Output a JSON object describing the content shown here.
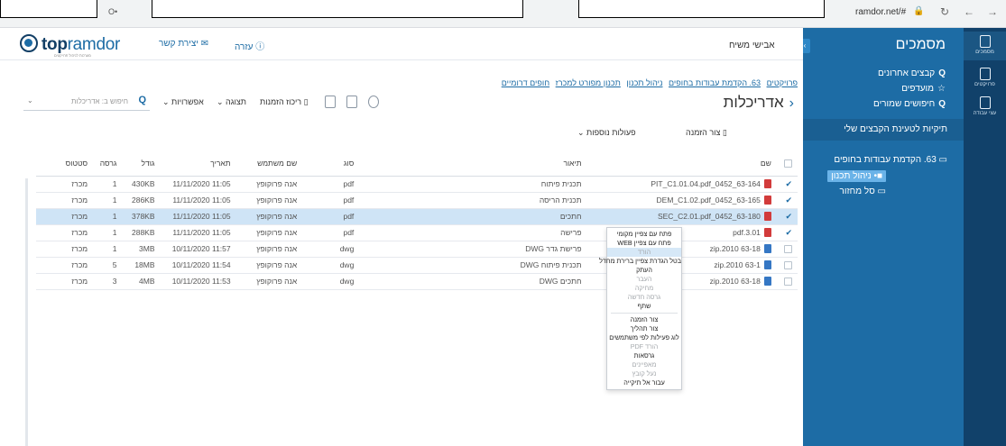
{
  "browser": {
    "url": "ramdor.net/#"
  },
  "app": {
    "logo_bold": "top",
    "logo_light": "ramdor",
    "logo_tagline": "מערכות לניהול פרויקטים",
    "help": "עזרה",
    "contact": "יצירת קשר",
    "user": "אבישי משיח"
  },
  "rail": [
    {
      "label": "מסמכים"
    },
    {
      "label": "פרויקטים"
    },
    {
      "label": "עצי עבודה"
    }
  ],
  "nav": {
    "title": "מסמכים",
    "links": [
      {
        "label": "קבצים אחרונים",
        "icon": "search-icon"
      },
      {
        "label": "מועדפים",
        "icon": "star-icon"
      },
      {
        "label": "חיפושים שמורים",
        "icon": "search-icon"
      }
    ],
    "upload_section": "תיקיות לטעינת הקבצים שלי",
    "tree": [
      {
        "label": "63. הקדמת עבודות בחופים"
      },
      {
        "label": "ניהול תכנון"
      },
      {
        "label": "סל מחזור"
      }
    ]
  },
  "breadcrumb": [
    "פרויקטים",
    "63. הקדמת עבודות בחופים",
    "ניהול תכנון",
    "תכנון מפורט למכרז",
    "חופים דרומיים"
  ],
  "heading": "אדריכלות",
  "toolbar": {
    "order_basket": "ריכוז הזמנות",
    "view": "תצוגה",
    "options": "אפשרויות",
    "search_placeholder": "חיפוש ב: אדריכלות",
    "create_order": "צור הזמנה",
    "more_actions": "פעולות נוספות"
  },
  "table": {
    "headers": [
      "שם",
      "תיאור",
      "סוג",
      "שם משתמש",
      "תאריך",
      "גודל",
      "גרסה",
      "סטטוס"
    ],
    "rows": [
      {
        "name": "63-164_0452_PIT_C1.01.04.pdf",
        "desc": "תכנית פיתוח",
        "type": "pdf",
        "user": "אנה פרוקופץ",
        "date": "11:05 11/11/2020",
        "size": "430KB",
        "ver": "1",
        "status": "מכרז",
        "checked": true,
        "ftype": "pdf"
      },
      {
        "name": "63-165_0452_DEM_C1.02.pdf",
        "desc": "תכנית הריסה",
        "type": "pdf",
        "user": "אנה פרוקופץ",
        "date": "11:05 11/11/2020",
        "size": "286KB",
        "ver": "1",
        "status": "מכרז",
        "checked": true,
        "ftype": "pdf"
      },
      {
        "name": "63-180_0452_SEC_C2.01.pdf",
        "desc": "חתכים",
        "type": "pdf",
        "user": "אנה פרוקופץ",
        "date": "11:05 11/11/2020",
        "size": "378KB",
        "ver": "1",
        "status": "מכרז",
        "checked": true,
        "ftype": "pdf"
      },
      {
        "name": "3.01.pdf",
        "desc": "פרישה",
        "type": "pdf",
        "user": "אנה פרוקופץ",
        "date": "11:05 11/11/2020",
        "size": "288KB",
        "ver": "1",
        "status": "מכרז",
        "checked": true,
        "ftype": "pdf"
      },
      {
        "name": "63-18 2010.zip",
        "desc": "פרישת גדר DWG",
        "type": "dwg",
        "user": "אנה פרוקופץ",
        "date": "11:57 10/11/2020",
        "size": "3MB",
        "ver": "1",
        "status": "מכרז",
        "checked": false,
        "ftype": "dwg"
      },
      {
        "name": "63-1 2010.zip",
        "desc": "תכנית פיתוח DWG",
        "type": "dwg",
        "user": "אנה פרוקופץ",
        "date": "11:54 10/11/2020",
        "size": "18MB",
        "ver": "5",
        "status": "מכרז",
        "checked": false,
        "ftype": "dwg"
      },
      {
        "name": "63-18 2010.zip",
        "desc": "חתכים DWG",
        "type": "dwg",
        "user": "אנה פרוקופץ",
        "date": "11:53 10/11/2020",
        "size": "4MB",
        "ver": "3",
        "status": "מכרז",
        "checked": false,
        "ftype": "dwg"
      }
    ]
  },
  "context_menu": {
    "items": [
      {
        "label": "פתח עם צפיין מקומי",
        "disabled": false
      },
      {
        "label": "פתח עם צפיין WEB",
        "disabled": false
      },
      {
        "label": "הורד",
        "disabled": true,
        "hover": true
      },
      {
        "label": "בטל הגדרת צפיין ברירת מחדל",
        "disabled": false
      },
      {
        "label": "העתק",
        "disabled": false
      },
      {
        "label": "העבר",
        "disabled": true
      },
      {
        "label": "מחיקה",
        "disabled": true
      },
      {
        "label": "גרסה חדשה",
        "disabled": true
      },
      {
        "label": "שתף",
        "disabled": false
      },
      {
        "sep": true
      },
      {
        "label": "צור הזמנה",
        "disabled": false
      },
      {
        "label": "צור תהליך",
        "disabled": false
      },
      {
        "label": "לוג פעילות לפי משתמשים",
        "disabled": false
      },
      {
        "label": "הורד PDF",
        "disabled": true
      },
      {
        "label": "גרסאות",
        "disabled": false
      },
      {
        "label": "מאפיינים",
        "disabled": true
      },
      {
        "label": "נעל קובץ",
        "disabled": true
      },
      {
        "label": "עבור אל תיקייה",
        "disabled": false
      }
    ]
  },
  "colors": {
    "brand": "#1d6ca5",
    "nav_bg": "#1d6ca5",
    "rail_bg": "#11416a",
    "highlight_row": "#cfe4f6"
  }
}
